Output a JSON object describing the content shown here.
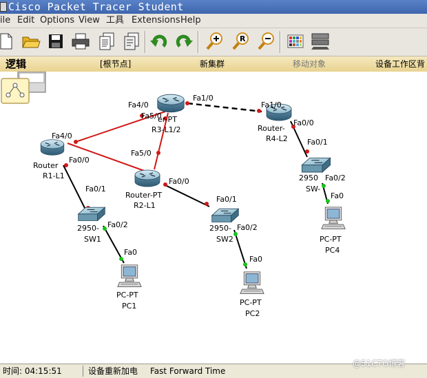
{
  "window": {
    "title": "Cisco Packet Tracer Student"
  },
  "menu": {
    "items": [
      "ile",
      "Edit",
      "Options",
      "View",
      "工具",
      "Extensions",
      "Help"
    ]
  },
  "toolbar": {
    "buttons": [
      "new-file-icon",
      "open-folder-icon",
      "save-icon",
      "print-icon",
      "activity-wizard-icon",
      "copy-icon",
      "undo-icon",
      "redo-icon",
      "zoom-in-icon",
      "zoom-reset-icon",
      "zoom-out-icon",
      "palette-icon",
      "custom-device-icon"
    ]
  },
  "logic_bar": {
    "title": "逻辑",
    "root": "[根节点]",
    "new_cluster": "新集群",
    "move_object": "移动对象",
    "workspace_list": "设备工作区背"
  },
  "topology": {
    "devices": {
      "r3": {
        "type_label": "er-PT",
        "name": "R3-L1/2"
      },
      "r1": {
        "type_label": "Router",
        "name": "R1-L1"
      },
      "r2": {
        "type_label": "Router-PT",
        "name": "R2-L1"
      },
      "r4": {
        "type_label": "Router-",
        "name": "R4-L2"
      },
      "sw1": {
        "type_label": "2950-",
        "name": "SW1"
      },
      "sw2": {
        "type_label": "2950-",
        "name": "SW2"
      },
      "sw4": {
        "type_label": "2950",
        "name": "SW-"
      },
      "pc1": {
        "type_label": "PC-PT",
        "name": "PC1"
      },
      "pc2": {
        "type_label": "PC-PT",
        "name": "PC2"
      },
      "pc4": {
        "type_label": "PC-PT",
        "name": "PC4"
      }
    },
    "ports": {
      "r3_fa40": "Fa4/0",
      "r3_fa50": "Fa5/0",
      "r3_fa10": "Fa1/0",
      "r3_fa50b": "Fa5/0",
      "r4_fa10": "Fa1/0",
      "r4_fa00": "Fa0/0",
      "r1_fa40": "Fa4/0",
      "r1_fa00": "Fa0/0",
      "r2_fa00": "Fa0/0",
      "sw1_fa01": "Fa0/1",
      "sw1_fa02": "Fa0/2",
      "sw2_fa01": "Fa0/1",
      "sw2_fa02": "Fa0/2",
      "sw4_fa01": "Fa0/1",
      "sw4_fa02": "Fa0/2",
      "pc1_fa0": "Fa0",
      "pc2_fa0": "Fa0",
      "pc4_fa0": "Fa0"
    },
    "link_colors": {
      "serial": "#d01818",
      "ethernet": "#000000",
      "up": "#19c419",
      "down": "#d01818"
    }
  },
  "statusbar": {
    "time": "时间: 04:15:51",
    "power_cycle": "设备重新加电",
    "fast_forward": "Fast Forward Time"
  },
  "watermark": "@51CTO博客"
}
